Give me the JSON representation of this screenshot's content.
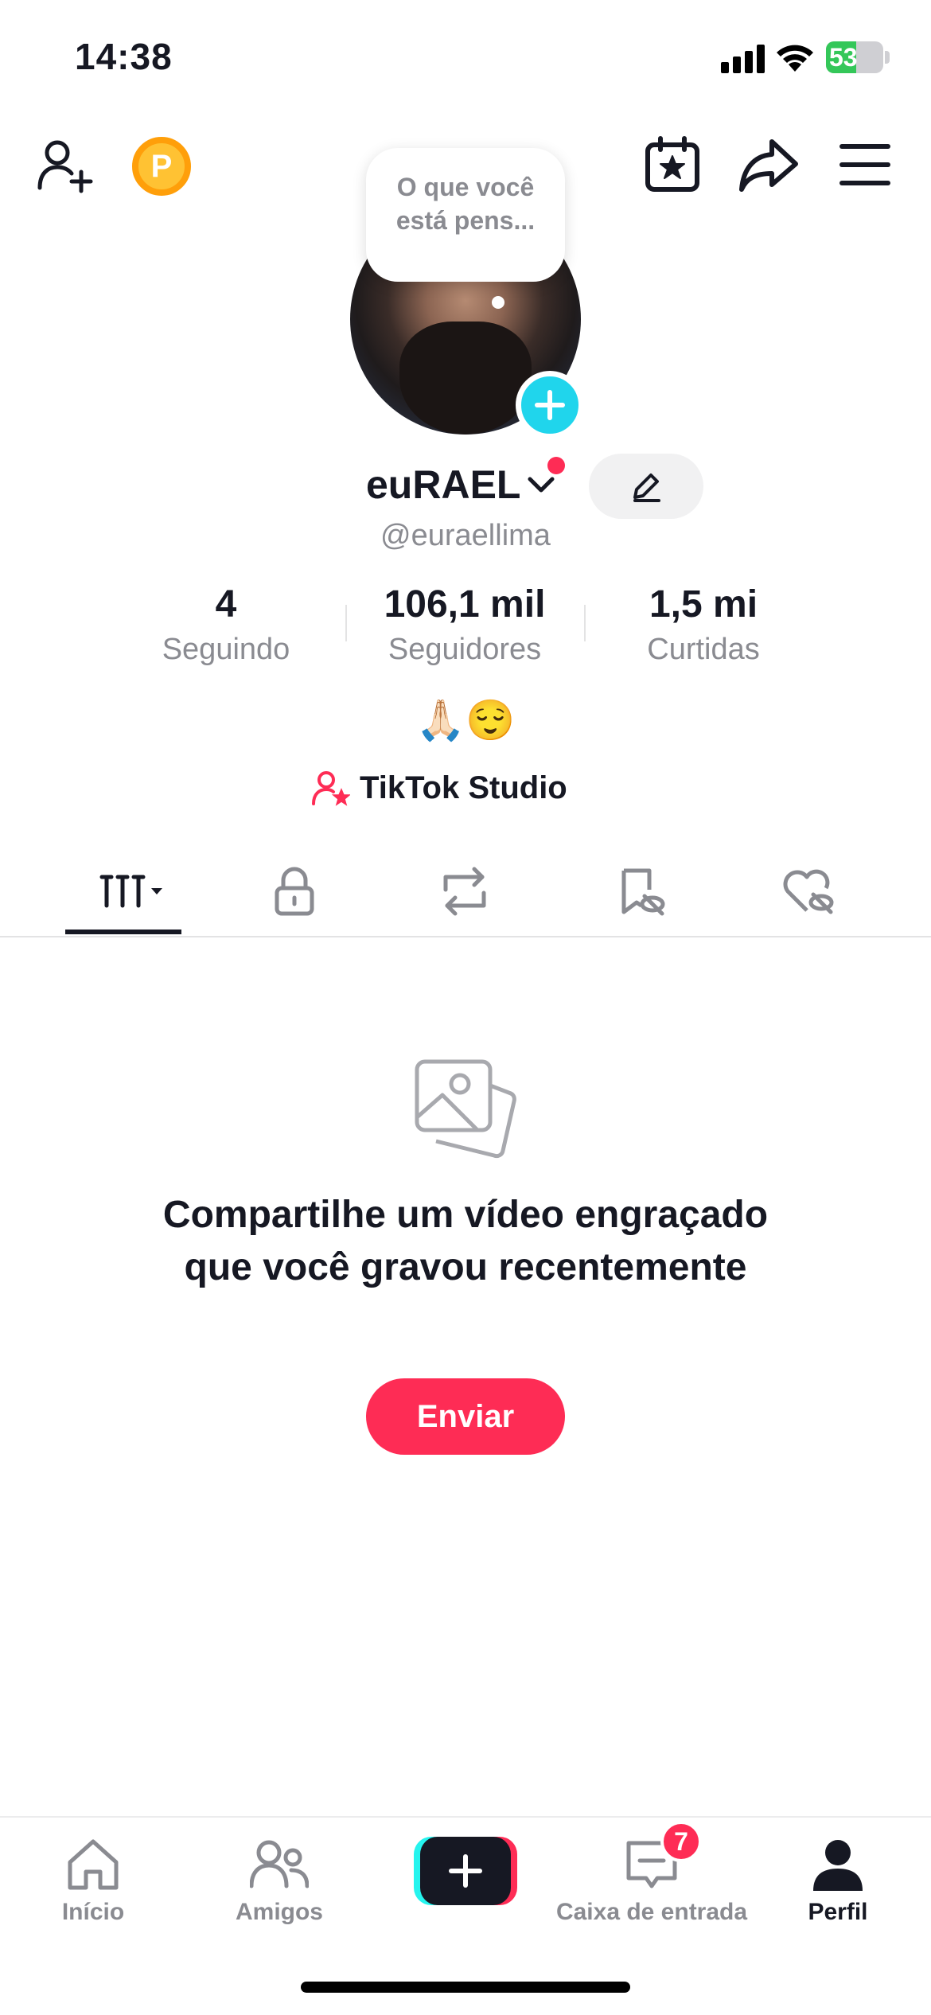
{
  "status_bar": {
    "time": "14:38",
    "battery": "53",
    "battery_level": 0.53
  },
  "header": {
    "icons": [
      "add-friend-icon",
      "coin-icon",
      "calendar-star-icon",
      "share-icon",
      "menu-icon"
    ],
    "coin_letter": "P"
  },
  "profile": {
    "thought_bubble": "O que você está pens...",
    "username": "euRAEL",
    "handle": "@euraellima",
    "stats": [
      {
        "value": "4",
        "label": "Seguindo"
      },
      {
        "value": "106,1 mil",
        "label": "Seguidores"
      },
      {
        "value": "1,5 mi",
        "label": "Curtidas"
      }
    ],
    "bio": "🙏🏻😌",
    "studio_link": "TikTok Studio"
  },
  "tabs": [
    "videos-grid-icon",
    "lock-icon",
    "repost-icon",
    "favorites-hidden-icon",
    "liked-hidden-icon"
  ],
  "empty_state": {
    "title": "Compartilhe um vídeo engraçado que você gravou recentemente",
    "button": "Enviar"
  },
  "bottom_nav": {
    "items": [
      {
        "label": "Início",
        "icon": "home-icon"
      },
      {
        "label": "Amigos",
        "icon": "friends-icon"
      },
      {
        "label": "",
        "icon": "create-icon"
      },
      {
        "label": "Caixa de entrada",
        "icon": "inbox-icon",
        "badge": "7"
      },
      {
        "label": "Perfil",
        "icon": "profile-icon"
      }
    ]
  },
  "colors": {
    "accent": "#fe2c55",
    "cyan": "#25f4ee",
    "text": "#161823",
    "muted": "#8a8b91",
    "coin": "#ffc233"
  }
}
